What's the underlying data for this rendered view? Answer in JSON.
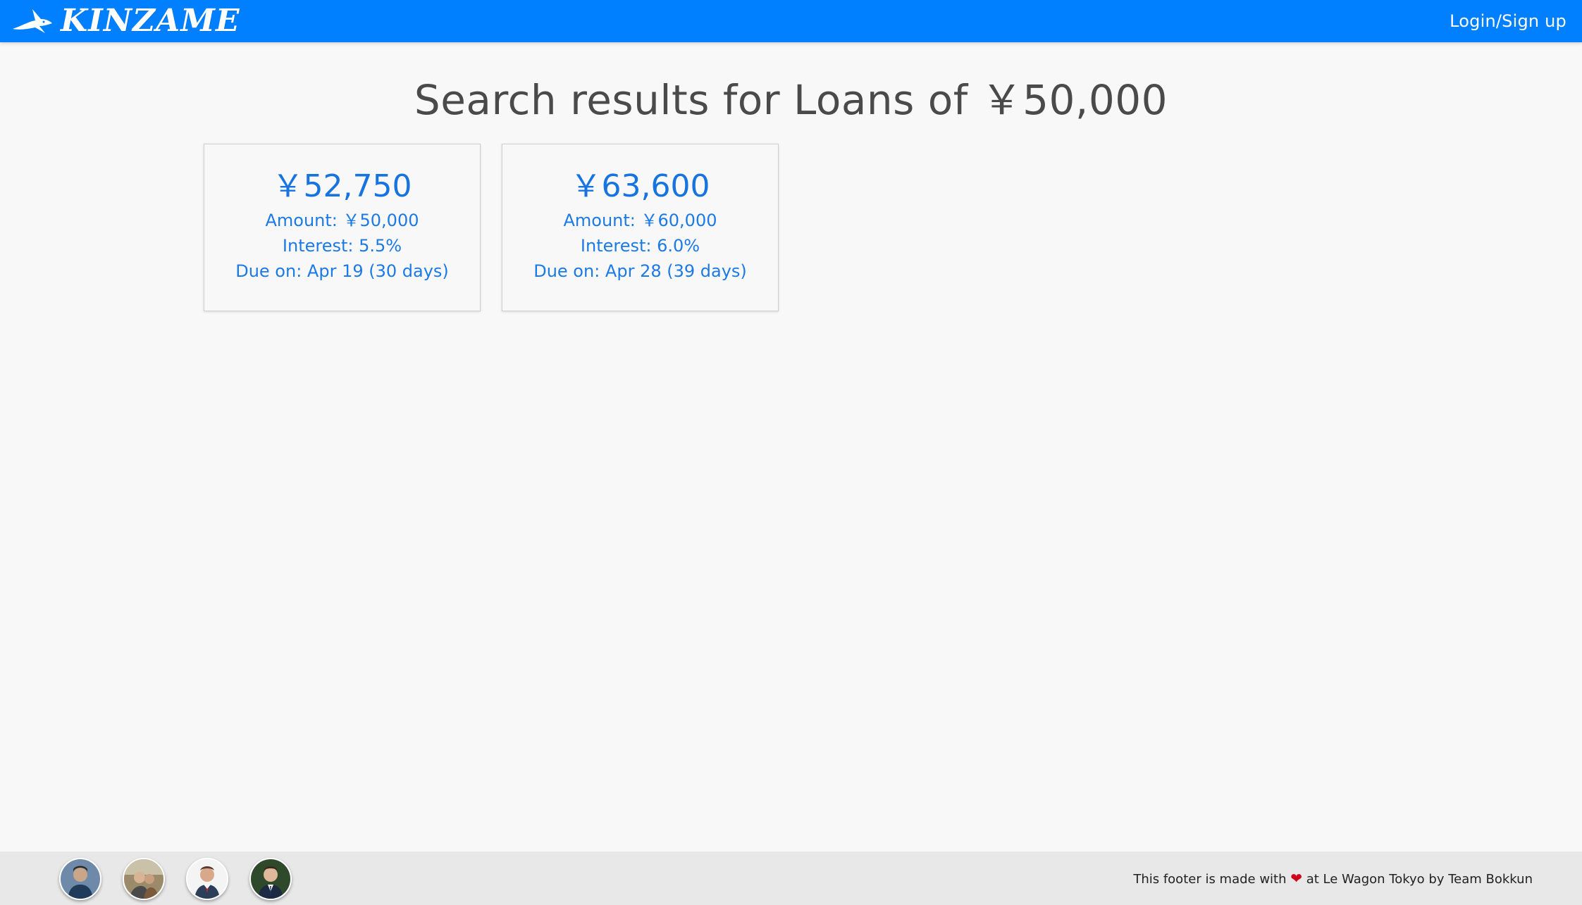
{
  "navbar": {
    "brand": "KINZAME",
    "login_label": "Login/Sign up"
  },
  "page": {
    "title": "Search results for Loans of ￥50,000"
  },
  "loans": [
    {
      "total": "￥52,750",
      "amount": "Amount: ￥50,000",
      "interest": "Interest: 5.5%",
      "due": "Due on: Apr 19 (30 days)"
    },
    {
      "total": "￥63,600",
      "amount": "Amount: ￥60,000",
      "interest": "Interest: 6.0%",
      "due": "Due on: Apr 28 (39 days)"
    }
  ],
  "footer": {
    "text_before": "This footer is made with ",
    "heart": "❤",
    "text_after": " at Le Wagon Tokyo by Team Bokkun",
    "avatars": [
      "team-member-1",
      "team-member-2",
      "team-member-3",
      "team-member-4"
    ]
  },
  "colors": {
    "navbar": "#0080ff",
    "accent_text": "#1c7ae6",
    "background": "#f8f8f8",
    "footer_bg": "#e8e8e8",
    "heart": "#d0021b"
  }
}
